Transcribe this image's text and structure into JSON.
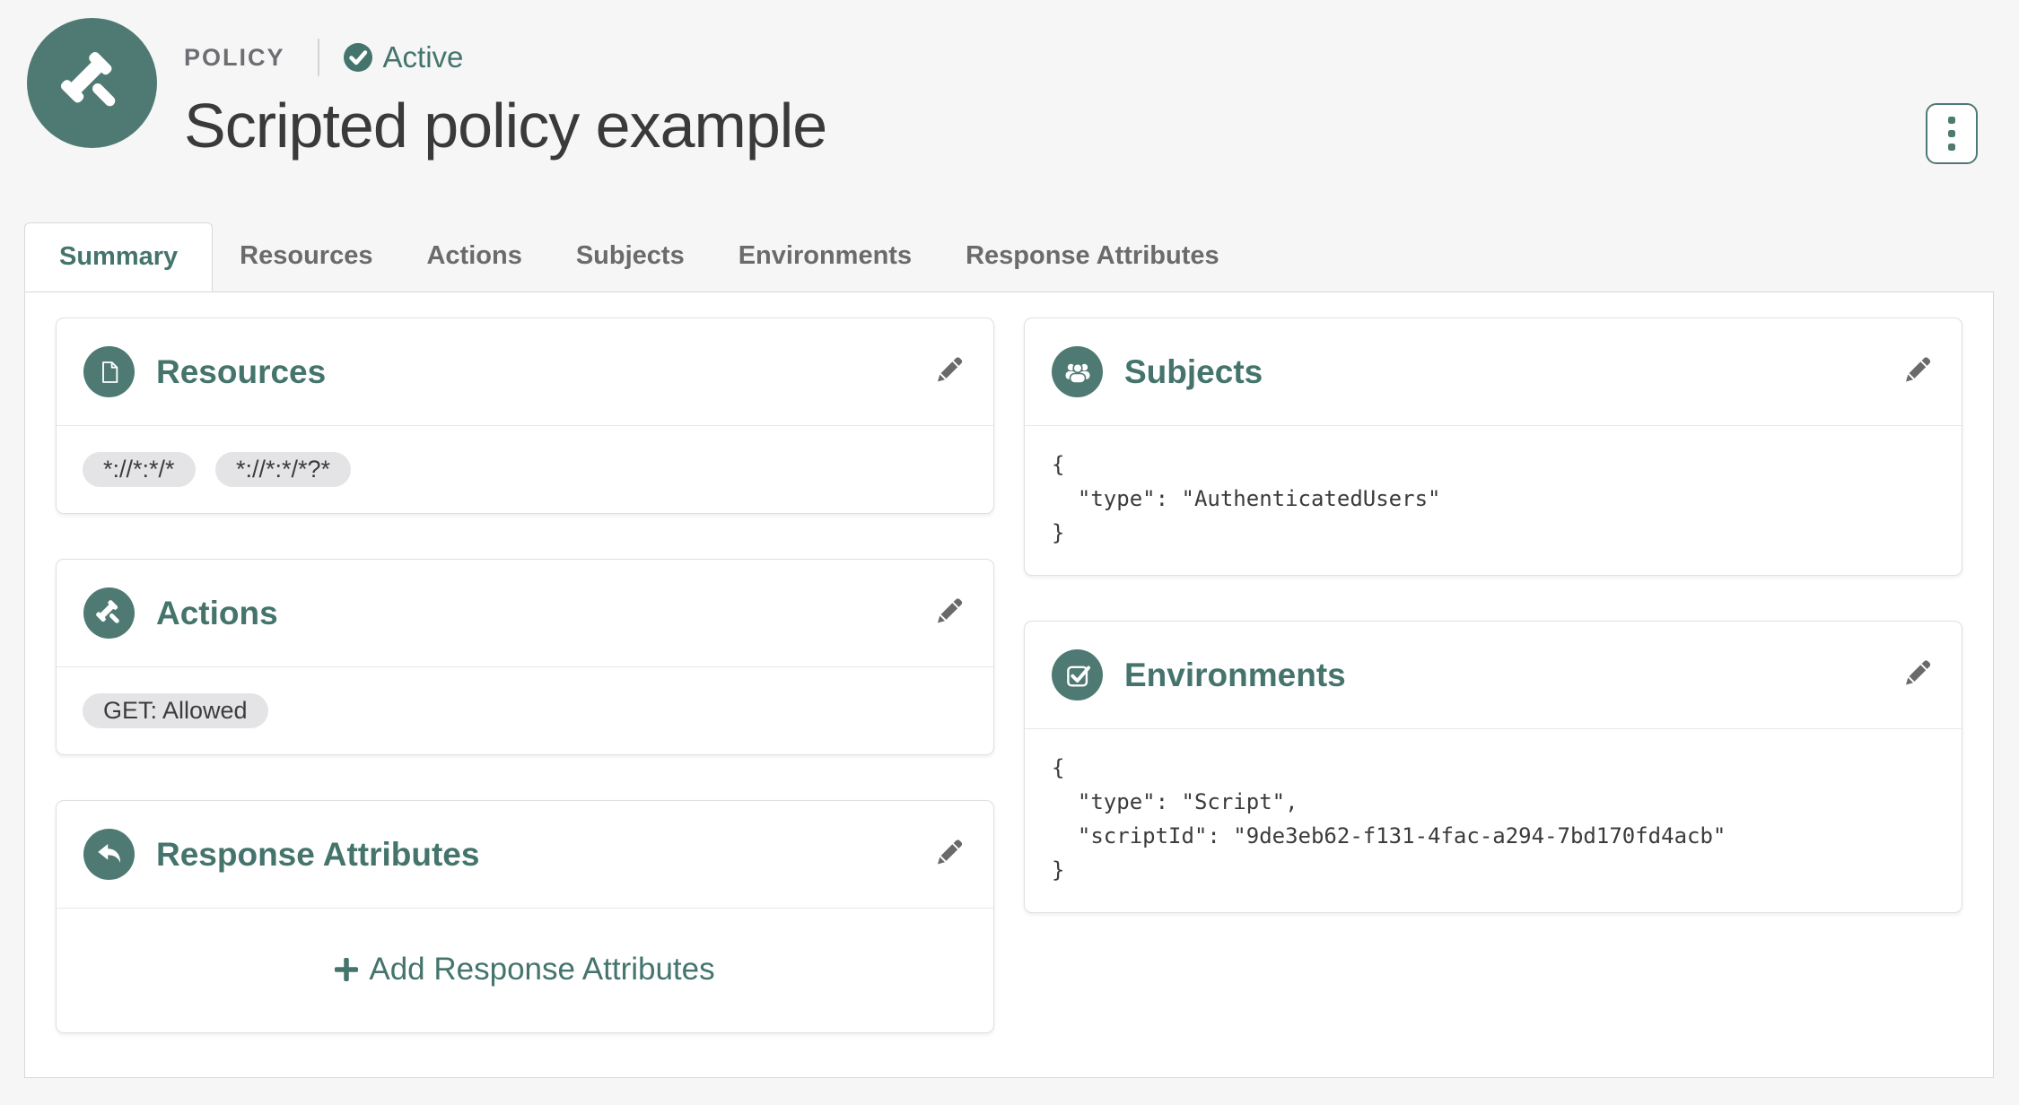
{
  "colors": {
    "accent": "#4e7a73",
    "page_bg": "#f6f6f7"
  },
  "header": {
    "eyebrow": "POLICY",
    "status_label": "Active",
    "title": "Scripted policy example"
  },
  "tabs": {
    "items": [
      {
        "label": "Summary"
      },
      {
        "label": "Resources"
      },
      {
        "label": "Actions"
      },
      {
        "label": "Subjects"
      },
      {
        "label": "Environments"
      },
      {
        "label": "Response Attributes"
      }
    ]
  },
  "cards": {
    "resources": {
      "title": "Resources",
      "tags": [
        "*://*:*/*",
        "*://*:*/*?*"
      ]
    },
    "actions": {
      "title": "Actions",
      "tags": [
        "GET: Allowed"
      ]
    },
    "response_attributes": {
      "title": "Response Attributes",
      "add_label": "Add Response Attributes"
    },
    "subjects": {
      "title": "Subjects",
      "code": "{\n  \"type\": \"AuthenticatedUsers\"\n}"
    },
    "environments": {
      "title": "Environments",
      "code": "{\n  \"type\": \"Script\",\n  \"scriptId\": \"9de3eb62-f131-4fac-a294-7bd170fd4acb\"\n}"
    }
  }
}
